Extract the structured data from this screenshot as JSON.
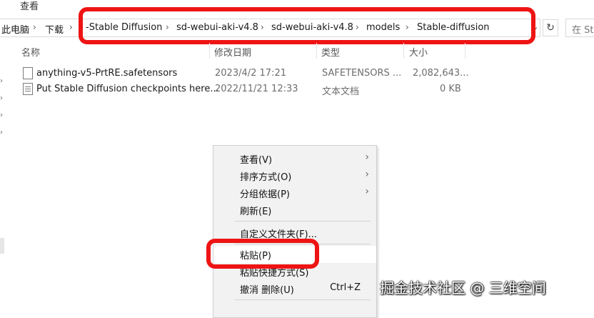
{
  "ribbon": {
    "view_label": "查看"
  },
  "address_bar": {
    "crumbs": [
      "此电脑",
      "下载",
      "-Stable Diffusion",
      "sd-webui-aki-v4.8",
      "sd-webui-aki-v4.8",
      "models",
      "Stable-diffusion"
    ],
    "separator": "›",
    "dropdown_icon": "⌄",
    "refresh_icon": "↻"
  },
  "search": {
    "placeholder": "在 Sta"
  },
  "columns": {
    "name": "名称",
    "modified": "修改日期",
    "type": "类型",
    "size": "大小"
  },
  "files": [
    {
      "name": "anything-v5-PrtRE.safetensors",
      "modified": "2023/4/2 17:21",
      "type": "SAFETENSORS ...",
      "size": "2,082,643..."
    },
    {
      "name": "Put Stable Diffusion checkpoints here...",
      "modified": "2022/11/21 12:33",
      "type": "文本文档",
      "size": "0 KB"
    }
  ],
  "context_menu": {
    "view": "查看(V)",
    "sort": "排序方式(O)",
    "group": "分组依据(P)",
    "refresh": "刷新(E)",
    "customize": "自定义文件夹(F)...",
    "paste": "粘贴(P)",
    "paste_shortcut": "粘贴快捷方式(S)",
    "undo_delete": "撤消 删除(U)",
    "undo_shortcut": "Ctrl+Z",
    "submenu_arrow": "›"
  },
  "watermark": "掘金技术社区 @ 三维空间",
  "colors": {
    "highlight": "#ee1414"
  }
}
